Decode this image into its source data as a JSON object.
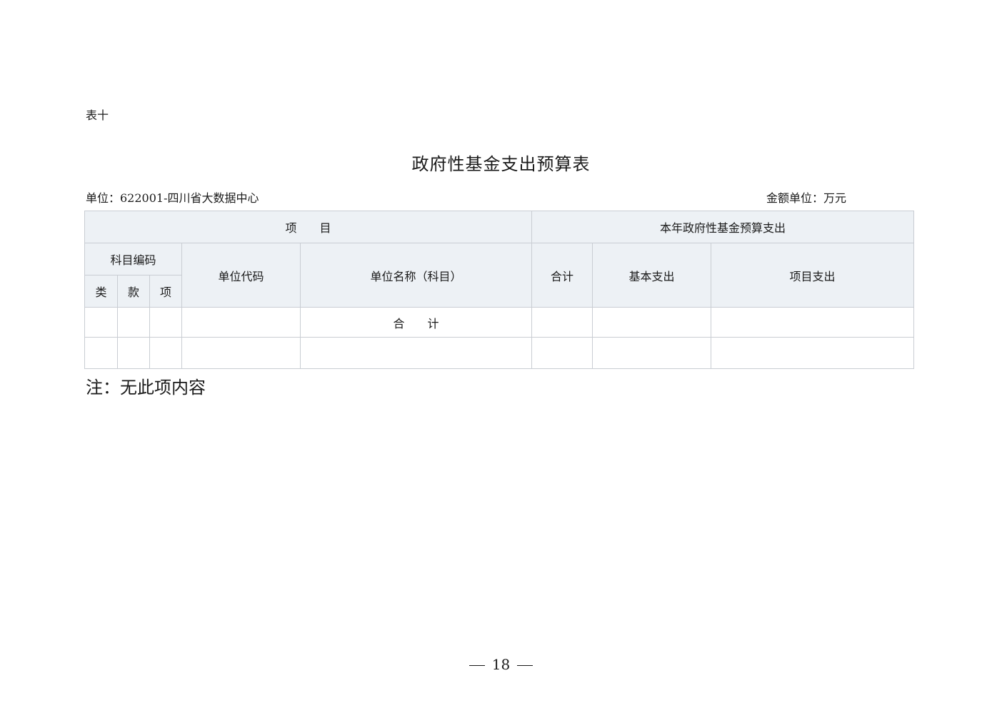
{
  "table_label": "表十",
  "title": "政府性基金支出预算表",
  "unit_info": {
    "unit": "单位：622001-四川省大数据中心",
    "amount_unit": "金额单位：万元"
  },
  "table": {
    "header_item": "项　　目",
    "header_budget": "本年政府性基金预算支出",
    "subject_code": "科目编码",
    "unit_code": "单位代码",
    "unit_name": "单位名称（科目）",
    "total_col": "合计",
    "basic_expense": "基本支出",
    "project_expense": "项目支出",
    "lei": "类",
    "kuan": "款",
    "xiang": "项",
    "total_row_label": "合　　计"
  },
  "note": "注：无此项内容",
  "page_number": "18"
}
